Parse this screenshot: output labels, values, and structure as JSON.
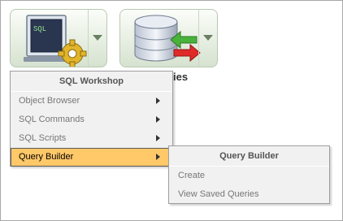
{
  "tiles": {
    "sql_workshop": {
      "screen_text": "SQL"
    },
    "query_builder": {
      "label_partial": "ies"
    }
  },
  "main_menu": {
    "title": "SQL Workshop",
    "items": [
      {
        "label": "Object Browser",
        "has_submenu": true
      },
      {
        "label": "SQL Commands",
        "has_submenu": true
      },
      {
        "label": "SQL Scripts",
        "has_submenu": true
      },
      {
        "label": "Query Builder",
        "has_submenu": true,
        "active": true
      }
    ]
  },
  "sub_menu": {
    "title": "Query Builder",
    "items": [
      {
        "label": "Create"
      },
      {
        "label": "View Saved Queries"
      }
    ]
  },
  "colors": {
    "highlight": "#ffc868",
    "menu_background": "#f1f1f1",
    "tile_accent": "#b9c9b1"
  },
  "icons": [
    "sql-monitor-icon",
    "gear-icon",
    "database-icon",
    "sync-arrows-icon",
    "dropdown-arrow-icon",
    "submenu-arrow-icon"
  ]
}
